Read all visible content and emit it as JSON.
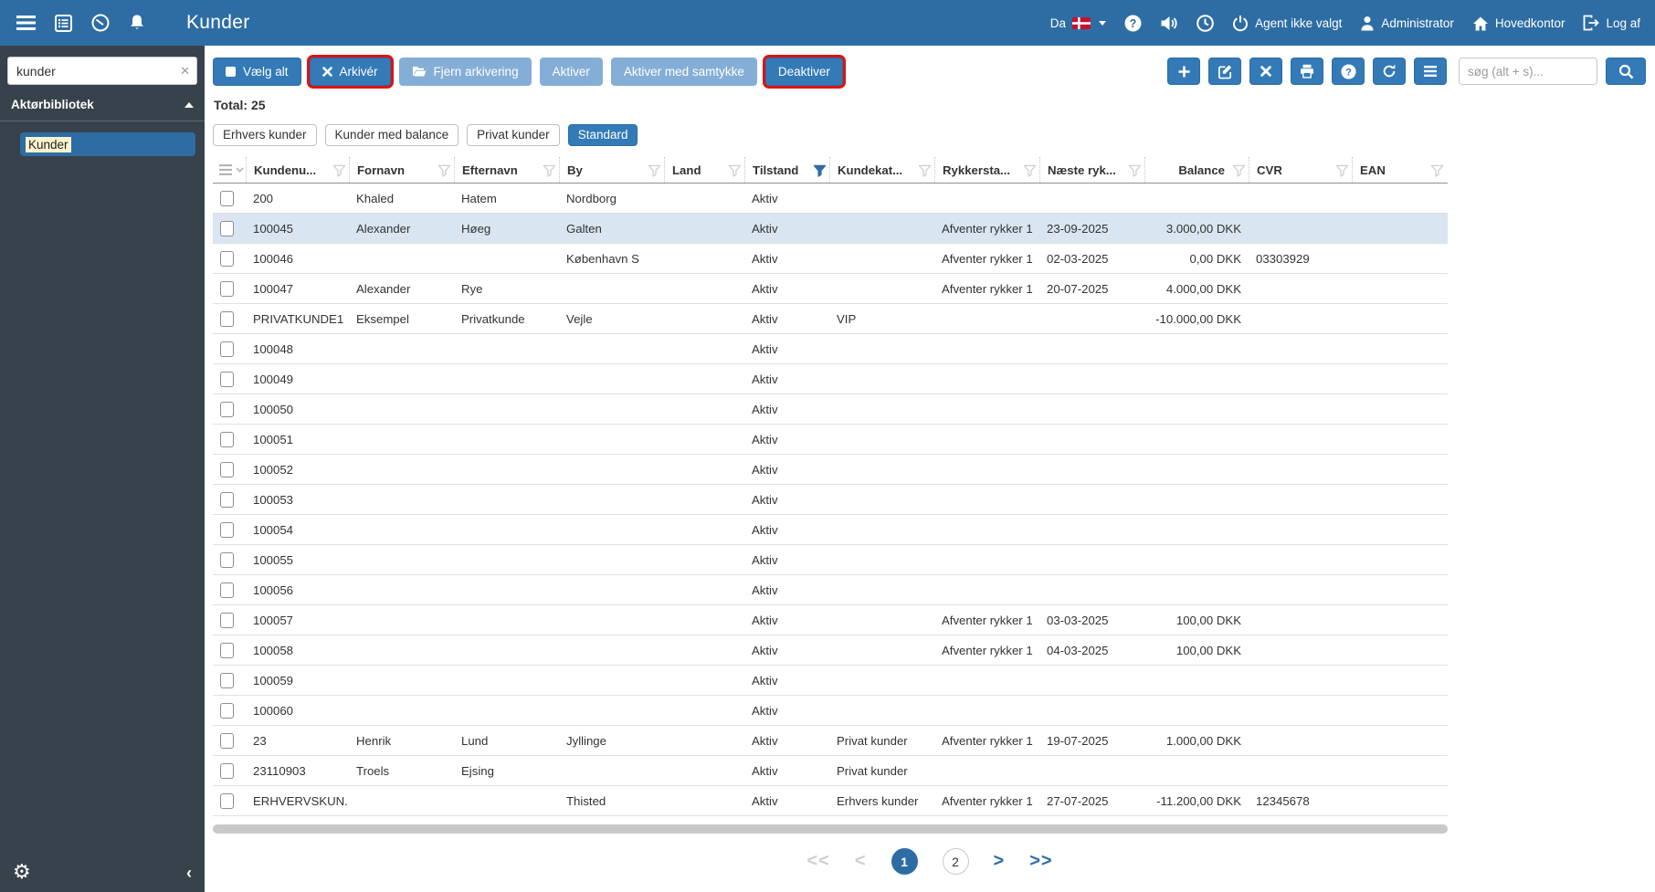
{
  "topbar": {
    "title": "Kunder",
    "language_label": "Da",
    "agent_label": "Agent ikke valgt",
    "user_label": "Administrator",
    "office_label": "Hovedkontor",
    "logout_label": "Log af"
  },
  "sidebar": {
    "search_value": "kunder",
    "section_title": "Aktørbibliotek",
    "item_label": "Kunder"
  },
  "actions": {
    "select_all": "Vælg alt",
    "archive": "Arkivér",
    "unarchive": "Fjern arkivering",
    "activate": "Aktiver",
    "activate_consent": "Aktiver med samtykke",
    "deactivate": "Deaktiver",
    "search_placeholder": "søg (alt + s)..."
  },
  "total_label": "Total: 25",
  "chips": [
    {
      "label": "Erhvers kunder",
      "active": false
    },
    {
      "label": "Kunder med balance",
      "active": false
    },
    {
      "label": "Privat kunder",
      "active": false
    },
    {
      "label": "Standard",
      "active": true
    }
  ],
  "table": {
    "columns": [
      {
        "label": "Kundenu...",
        "filter_active": false
      },
      {
        "label": "Fornavn",
        "filter_active": false
      },
      {
        "label": "Efternavn",
        "filter_active": false
      },
      {
        "label": "By",
        "filter_active": false
      },
      {
        "label": "Land",
        "filter_active": false
      },
      {
        "label": "Tilstand",
        "filter_active": true
      },
      {
        "label": "Kundekat...",
        "filter_active": false
      },
      {
        "label": "Rykkersta...",
        "filter_active": false
      },
      {
        "label": "Næste ryk...",
        "filter_active": false
      },
      {
        "label": "Balance",
        "filter_active": false
      },
      {
        "label": "CVR",
        "filter_active": false
      },
      {
        "label": "EAN",
        "filter_active": false
      }
    ],
    "rows": [
      {
        "selected": false,
        "cells": [
          "200",
          "Khaled",
          "Hatem",
          "Nordborg",
          "",
          "Aktiv",
          "",
          "",
          "",
          "",
          "",
          ""
        ]
      },
      {
        "selected": true,
        "cells": [
          "100045",
          "Alexander",
          "Høeg",
          "Galten",
          "",
          "Aktiv",
          "",
          "Afventer rykker 1",
          "23-09-2025",
          "3.000,00 DKK",
          "",
          ""
        ]
      },
      {
        "selected": false,
        "cells": [
          "100046",
          "",
          "",
          "København S",
          "",
          "Aktiv",
          "",
          "Afventer rykker 1",
          "02-03-2025",
          "0,00 DKK",
          "03303929",
          ""
        ]
      },
      {
        "selected": false,
        "cells": [
          "100047",
          "Alexander",
          "Rye",
          "",
          "",
          "Aktiv",
          "",
          "Afventer rykker 1",
          "20-07-2025",
          "4.000,00 DKK",
          "",
          ""
        ]
      },
      {
        "selected": false,
        "cells": [
          "PRIVATKUNDE1",
          "Eksempel",
          "Privatkunde",
          "Vejle",
          "",
          "Aktiv",
          "VIP",
          "",
          "",
          "-10.000,00 DKK",
          "",
          ""
        ]
      },
      {
        "selected": false,
        "cells": [
          "100048",
          "",
          "",
          "",
          "",
          "Aktiv",
          "",
          "",
          "",
          "",
          "",
          ""
        ]
      },
      {
        "selected": false,
        "cells": [
          "100049",
          "",
          "",
          "",
          "",
          "Aktiv",
          "",
          "",
          "",
          "",
          "",
          ""
        ]
      },
      {
        "selected": false,
        "cells": [
          "100050",
          "",
          "",
          "",
          "",
          "Aktiv",
          "",
          "",
          "",
          "",
          "",
          ""
        ]
      },
      {
        "selected": false,
        "cells": [
          "100051",
          "",
          "",
          "",
          "",
          "Aktiv",
          "",
          "",
          "",
          "",
          "",
          ""
        ]
      },
      {
        "selected": false,
        "cells": [
          "100052",
          "",
          "",
          "",
          "",
          "Aktiv",
          "",
          "",
          "",
          "",
          "",
          ""
        ]
      },
      {
        "selected": false,
        "cells": [
          "100053",
          "",
          "",
          "",
          "",
          "Aktiv",
          "",
          "",
          "",
          "",
          "",
          ""
        ]
      },
      {
        "selected": false,
        "cells": [
          "100054",
          "",
          "",
          "",
          "",
          "Aktiv",
          "",
          "",
          "",
          "",
          "",
          ""
        ]
      },
      {
        "selected": false,
        "cells": [
          "100055",
          "",
          "",
          "",
          "",
          "Aktiv",
          "",
          "",
          "",
          "",
          "",
          ""
        ]
      },
      {
        "selected": false,
        "cells": [
          "100056",
          "",
          "",
          "",
          "",
          "Aktiv",
          "",
          "",
          "",
          "",
          "",
          ""
        ]
      },
      {
        "selected": false,
        "cells": [
          "100057",
          "",
          "",
          "",
          "",
          "Aktiv",
          "",
          "Afventer rykker 1",
          "03-03-2025",
          "100,00 DKK",
          "",
          ""
        ]
      },
      {
        "selected": false,
        "cells": [
          "100058",
          "",
          "",
          "",
          "",
          "Aktiv",
          "",
          "Afventer rykker 1",
          "04-03-2025",
          "100,00 DKK",
          "",
          ""
        ]
      },
      {
        "selected": false,
        "cells": [
          "100059",
          "",
          "",
          "",
          "",
          "Aktiv",
          "",
          "",
          "",
          "",
          "",
          ""
        ]
      },
      {
        "selected": false,
        "cells": [
          "100060",
          "",
          "",
          "",
          "",
          "Aktiv",
          "",
          "",
          "",
          "",
          "",
          ""
        ]
      },
      {
        "selected": false,
        "cells": [
          "23",
          "Henrik",
          "Lund",
          "Jyllinge",
          "",
          "Aktiv",
          "Privat kunder",
          "Afventer rykker 1",
          "19-07-2025",
          "1.000,00 DKK",
          "",
          ""
        ]
      },
      {
        "selected": false,
        "cells": [
          "23110903",
          "Troels",
          "Ejsing",
          "",
          "",
          "Aktiv",
          "Privat kunder",
          "",
          "",
          "",
          "",
          ""
        ]
      },
      {
        "selected": false,
        "cells": [
          "ERHVERVSKUN...",
          "",
          "",
          "Thisted",
          "",
          "Aktiv",
          "Erhvers kunder",
          "Afventer rykker 1",
          "27-07-2025",
          "-11.200,00 DKK",
          "12345678",
          ""
        ]
      }
    ]
  },
  "pagination": {
    "first_label": "<<",
    "prev_label": "<",
    "pages": [
      {
        "label": "1",
        "current": true
      },
      {
        "label": "2",
        "current": false
      }
    ],
    "next_label": ">",
    "last_label": ">>"
  },
  "colors": {
    "topbar": "#2e6da4",
    "sidebar": "#37424c",
    "button_primary": "#337ab7",
    "button_light": "#85aed6",
    "highlight_border": "#de1212",
    "selected_row": "#d9e5f1",
    "filter_active": "#2e6da4"
  }
}
